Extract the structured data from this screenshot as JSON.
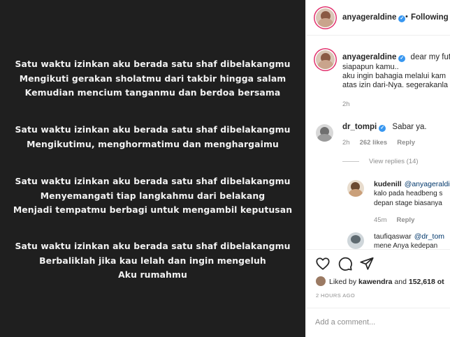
{
  "post": {
    "stanzas": [
      {
        "lines": [
          "Satu waktu izinkan aku berada satu shaf dibelakangmu",
          "Mengikuti gerakan sholatmu dari takbir hingga salam",
          "Kemudian mencium tanganmu dan berdoa bersama"
        ]
      },
      {
        "lines": [
          "Satu waktu izinkan aku berada satu shaf dibelakangmu",
          "Mengikutimu, menghormatimu dan menghargaimu"
        ]
      },
      {
        "lines": [
          "Satu waktu izinkan aku berada satu shaf dibelakangmu",
          "Menyemangati tiap langkahmu dari belakang",
          "Menjadi tempatmu berbagi untuk mengambil keputusan"
        ]
      },
      {
        "lines": [
          "Satu waktu izinkan aku berada satu shaf dibelakangmu",
          "Berbaliklah jika kau lelah dan ingin mengeluh",
          "Aku rumahmu"
        ]
      }
    ]
  },
  "header": {
    "username": "anyageraldine",
    "verified_glyph": "✓",
    "separator": "•",
    "follow_label": "Following"
  },
  "caption": {
    "username": "anyageraldine",
    "lines": [
      "dear my futu",
      "siapapun kamu..",
      "aku ingin bahagia melalui kam",
      "atas izin dari-Nya. segerakanla"
    ],
    "time": "2h"
  },
  "comments": [
    {
      "username": "dr_tompi",
      "text": "Sabar ya.",
      "time": "2h",
      "likes": "262 likes",
      "reply_label": "Reply",
      "view_replies": "View replies (14)",
      "replies": [
        {
          "username": "kudenill",
          "mention": "@anyageraldi",
          "lines": [
            "kalo pada headbeng s",
            "depan stage biasanya"
          ],
          "time": "45m",
          "reply_label": "Reply"
        },
        {
          "username": "taufiqaswar",
          "mention": "@dr_tom",
          "text": "mene Anya kedepan"
        }
      ]
    }
  ],
  "actions": {
    "like_icon": "heart-icon",
    "comment_icon": "comment-bubble-icon",
    "share_icon": "paper-plane-icon",
    "liked_by_prefix": "Liked by",
    "liked_by_user": "kawendra",
    "liked_by_and": "and",
    "liked_by_count": "152,618 ot",
    "timestamp": "2 HOURS AGO",
    "add_comment_placeholder": "Add a comment..."
  },
  "colors": {
    "post_background": "#1f1f1f",
    "post_text": "#f2f2f2",
    "verified_badge": "#3897f0",
    "meta_text": "#8e8e8e",
    "mention_link": "#00376b"
  }
}
